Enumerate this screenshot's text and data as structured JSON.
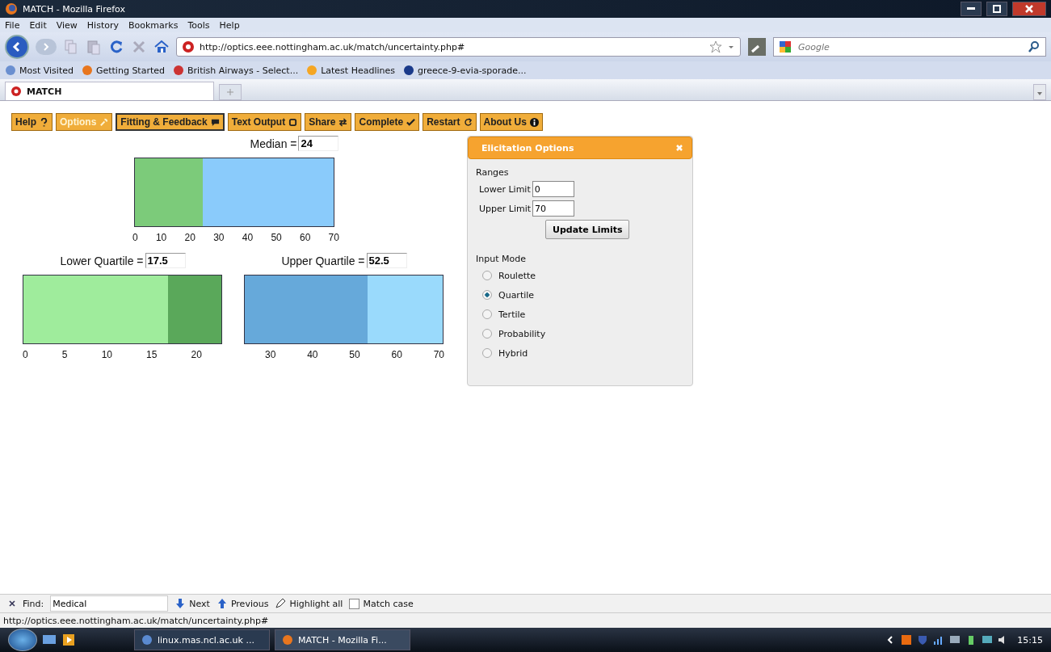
{
  "window": {
    "title": "MATCH - Mozilla Firefox"
  },
  "menu": [
    "File",
    "Edit",
    "View",
    "History",
    "Bookmarks",
    "Tools",
    "Help"
  ],
  "address": {
    "url": "http://optics.eee.nottingham.ac.uk/match/uncertainty.php#"
  },
  "search": {
    "placeholder": "Google"
  },
  "bookmarks": [
    "Most Visited",
    "Getting Started",
    "British Airways - Select...",
    "Latest Headlines",
    "greece-9-evia-sporade..."
  ],
  "tabs": [
    {
      "label": "MATCH",
      "selected": true
    }
  ],
  "toolbar": [
    {
      "label": "Help",
      "selected": false,
      "focused": false
    },
    {
      "label": "Options",
      "selected": true,
      "focused": false
    },
    {
      "label": "Fitting & Feedback",
      "selected": false,
      "focused": true
    },
    {
      "label": "Text Output",
      "selected": false,
      "focused": false
    },
    {
      "label": "Share",
      "selected": false,
      "focused": false
    },
    {
      "label": "Complete",
      "selected": false,
      "focused": false
    },
    {
      "label": "Restart",
      "selected": false,
      "focused": false
    },
    {
      "label": "About Us",
      "selected": false,
      "focused": false
    }
  ],
  "median": {
    "label": "Median =",
    "value": "24",
    "level": 0.343,
    "ticks": [
      "0",
      "10",
      "20",
      "30",
      "40",
      "50",
      "60",
      "70"
    ]
  },
  "lower_quartile": {
    "label": "Lower Quartile =",
    "value": "17.5",
    "level": 0.729,
    "ticks": [
      "0",
      "5",
      "10",
      "15",
      "20"
    ]
  },
  "upper_quartile": {
    "label": "Upper Quartile =",
    "value": "52.5",
    "level": 0.62,
    "ticks": [
      "30",
      "40",
      "50",
      "60",
      "70"
    ]
  },
  "dialog": {
    "title": "Elicitation Options",
    "ranges_heading": "Ranges",
    "fields": [
      {
        "label": "Lower Limit",
        "value": "0"
      },
      {
        "label": "Upper Limit",
        "value": "70"
      }
    ],
    "update_button": "Update Limits",
    "mode_heading": "Input Mode",
    "modes": [
      {
        "label": "Roulette",
        "selected": false
      },
      {
        "label": "Quartile",
        "selected": true
      },
      {
        "label": "Tertile",
        "selected": false
      },
      {
        "label": "Probability",
        "selected": false
      },
      {
        "label": "Hybrid",
        "selected": false
      }
    ]
  },
  "find_bar": {
    "label": "Find:",
    "value": "Medical",
    "next": "Next",
    "previous": "Previous",
    "highlight": "Highlight all",
    "match_case": {
      "label": "Match case",
      "checked": false
    }
  },
  "status_bar": "http://optics.eee.nottingham.ac.uk/match/uncertainty.php#",
  "taskbar": {
    "items": [
      {
        "label": "linux.mas.ncl.ac.uk ...",
        "selected": false
      },
      {
        "label": "MATCH - Mozilla Fi...",
        "selected": true
      }
    ],
    "clock": "15:15"
  }
}
